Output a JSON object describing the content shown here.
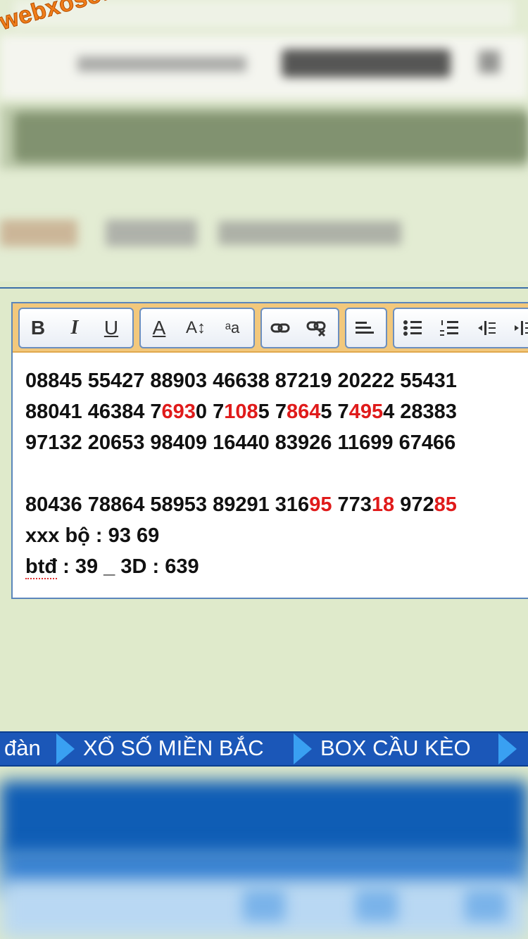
{
  "watermark": {
    "text": "webxoso.net"
  },
  "editor": {
    "toolbar": {
      "bold_label": "B",
      "italic_label": "I",
      "underline_label": "U",
      "font_color_label": "A",
      "font_size_label": "A↕",
      "font_family_label": "ᵃa",
      "buttons": [
        "bold",
        "italic",
        "underline",
        "font-color",
        "font-size",
        "font-family",
        "link",
        "unlink",
        "align-left",
        "bullet-list",
        "numbered-list",
        "outdent",
        "indent"
      ]
    },
    "lines": [
      [
        {
          "t": "08845 55427 88903 46638 87219 20222 55431"
        }
      ],
      [
        {
          "t": "88041 46384 7"
        },
        {
          "t": "693",
          "red": true
        },
        {
          "t": "0 7"
        },
        {
          "t": "108",
          "red": true
        },
        {
          "t": "5 7"
        },
        {
          "t": "864",
          "red": true
        },
        {
          "t": "5 7"
        },
        {
          "t": "495",
          "red": true
        },
        {
          "t": "4 28383"
        }
      ],
      [
        {
          "t": "97132 20653 98409 16440 83926 11699 67466"
        }
      ],
      [
        {
          "t": ""
        }
      ],
      [
        {
          "t": "80436 78864 58953 89291 316"
        },
        {
          "t": "95",
          "red": true
        },
        {
          "t": " 773"
        },
        {
          "t": "18",
          "red": true
        },
        {
          "t": " 972"
        },
        {
          "t": "85",
          "red": true
        }
      ],
      [
        {
          "t": "xxx bộ : 93 69"
        }
      ],
      [
        {
          "t": "btđ",
          "spell": true
        },
        {
          "t": " : 39 _ 3D : 639"
        }
      ]
    ]
  },
  "navbar": {
    "items": [
      "đàn",
      "XỔ SỐ MIỀN BẮC",
      "BOX CẦU KÈO"
    ]
  },
  "colors": {
    "background": "#dfeacb",
    "toolbar": "#f2c87c",
    "highlight": "#e01b1b",
    "navbar": "#1b57b8",
    "arrow": "#39a0f2"
  }
}
